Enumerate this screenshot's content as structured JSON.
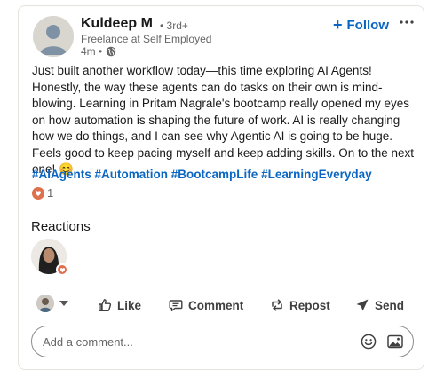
{
  "post": {
    "author": {
      "name": "Kuldeep M",
      "degree": "• 3rd+",
      "headline": "Freelance at Self Employed",
      "time": "4m •",
      "visibility_icon": "globe-icon"
    },
    "follow_label": "Follow",
    "follow_icon": "plus-icon",
    "more_icon": "ellipsis-icon",
    "body": "Just built another workflow today—this time exploring AI Agents! Honestly, the way these agents can do tasks on their own is mind-blowing. Learning in Pritam Nagrale's bootcamp really opened my eyes on how automation is shaping the future of work. AI is really changing how we do things, and I can see why Agentic AI is going to be huge. Feels good to keep pacing myself and keep adding skills. On to the next one! 😊",
    "hashtags": [
      "#AIAgents",
      "#Automation",
      "#BootcampLife",
      "#LearningEveryday"
    ],
    "reaction_count": "1",
    "reaction_icon": "heart-icon",
    "accent_color": "#0a66c2",
    "heart_color": "#df704d"
  },
  "reactions": {
    "title": "Reactions"
  },
  "actions": {
    "like": "Like",
    "comment": "Comment",
    "repost": "Repost",
    "send": "Send"
  },
  "comment_box": {
    "placeholder": "Add a comment...",
    "value": "",
    "emoji_icon": "emoji-icon",
    "image_icon": "image-icon"
  }
}
